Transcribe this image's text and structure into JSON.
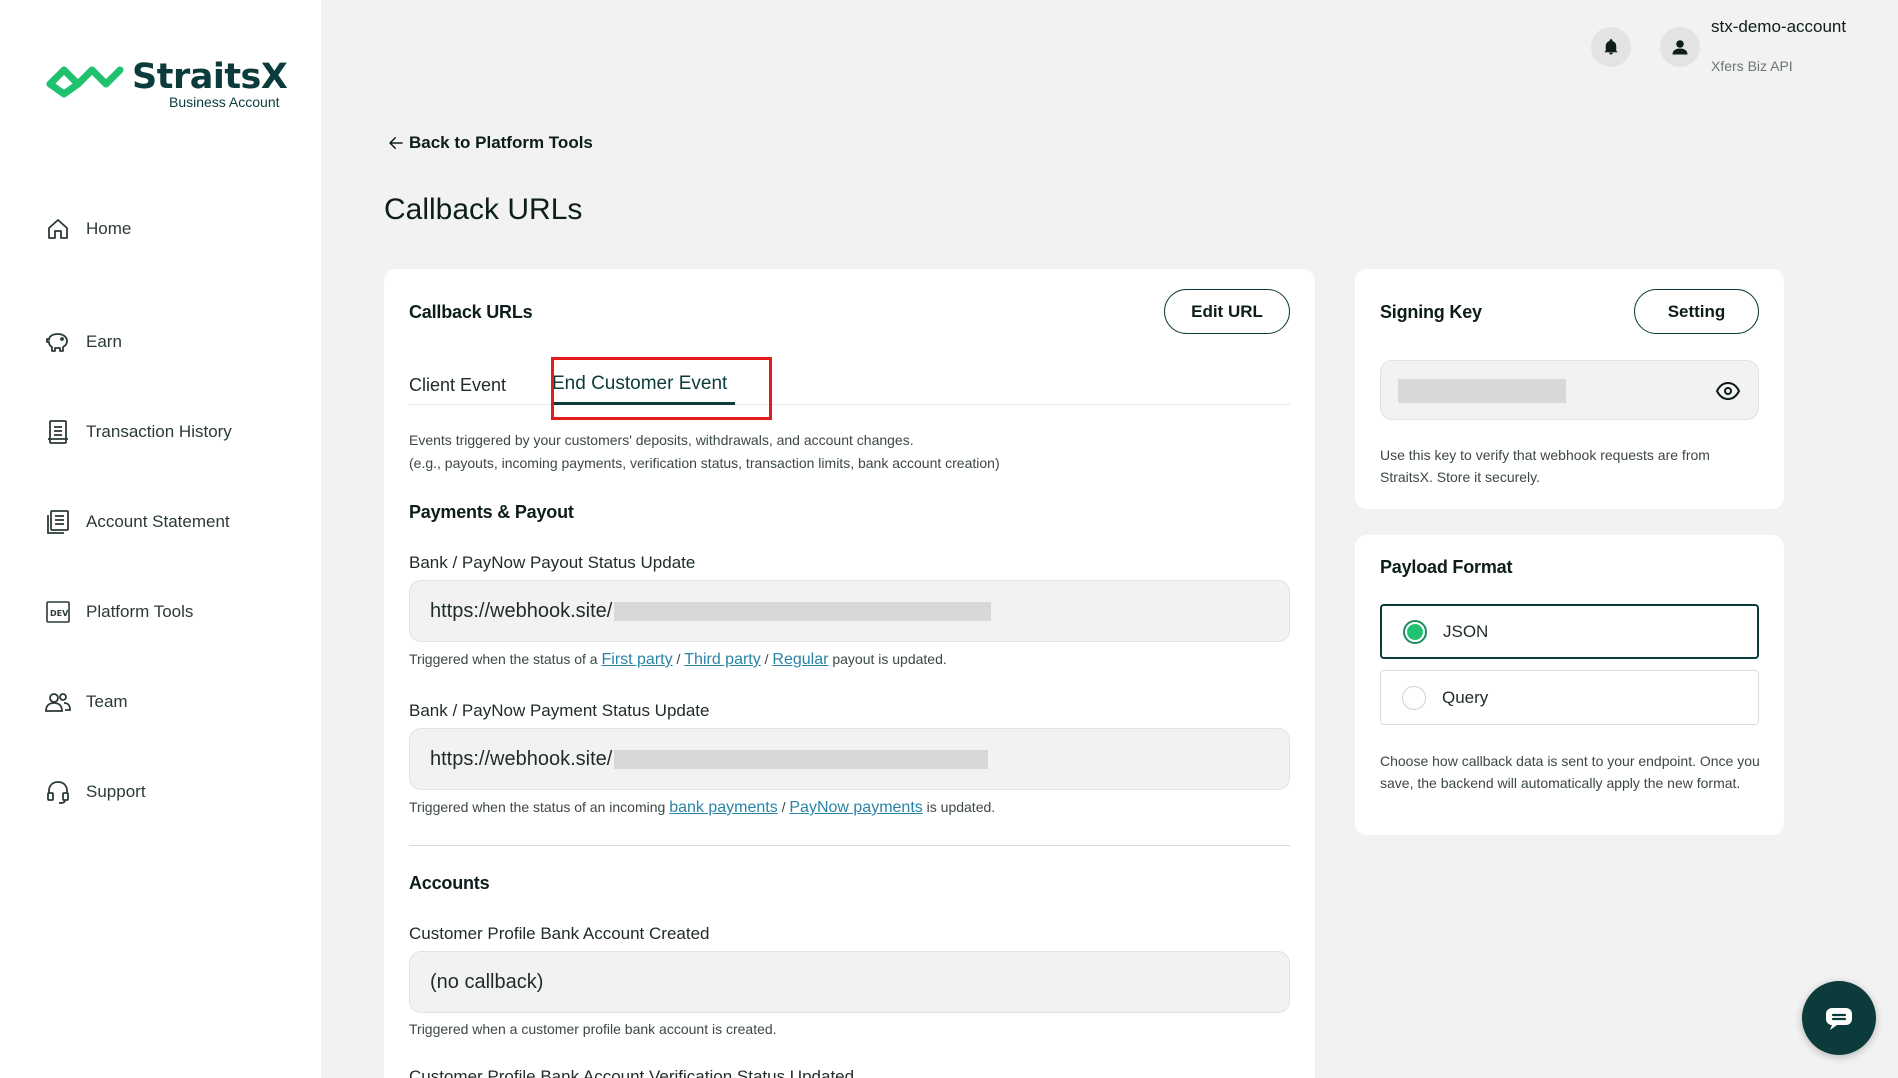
{
  "brand": {
    "name": "StraitsX",
    "subtitle": "Business Account",
    "color": "#0b3b3a",
    "accent": "#21c26f"
  },
  "sidebar": {
    "items": [
      {
        "label": "Home",
        "icon": "home-icon"
      },
      {
        "label": "Earn",
        "icon": "piggy-bank-icon"
      },
      {
        "label": "Transaction History",
        "icon": "receipt-icon"
      },
      {
        "label": "Account Statement",
        "icon": "statement-icon"
      },
      {
        "label": "Platform Tools",
        "icon": "dev-icon"
      },
      {
        "label": "Team",
        "icon": "team-icon"
      },
      {
        "label": "Support",
        "icon": "headset-icon"
      }
    ]
  },
  "header": {
    "account_name": "stx-demo-account",
    "account_sub": "Xfers Biz API"
  },
  "page": {
    "back_label": "Back to Platform Tools",
    "title": "Callback URLs"
  },
  "callbacks": {
    "title": "Callback URLs",
    "edit_label": "Edit URL",
    "tabs": [
      {
        "label": "Client Event"
      },
      {
        "label": "End Customer Event"
      }
    ],
    "description_line1": "Events triggered by your customers' deposits, withdrawals, and account changes.",
    "description_line2": "(e.g., payouts, incoming payments, verification status, transaction limits, bank account creation)",
    "section_payments": "Payments & Payout",
    "payout": {
      "label": "Bank / PayNow Payout Status Update",
      "value": "https://webhook.site/",
      "help_prefix": "Triggered when the status of a ",
      "link1": "First party",
      "sep1": " / ",
      "link2": "Third party",
      "sep2": " / ",
      "link3": "Regular",
      "help_suffix": " payout is updated."
    },
    "payment": {
      "label": "Bank / PayNow Payment Status Update",
      "value": "https://webhook.site/",
      "help_prefix": "Triggered when the status of an incoming ",
      "link1": "bank payments",
      "sep1": " / ",
      "link2": "PayNow payments",
      "help_suffix": " is updated."
    },
    "section_accounts": "Accounts",
    "bank_created": {
      "label": "Customer Profile Bank Account Created",
      "value": "(no callback)",
      "help": "Triggered when a customer profile bank account is created."
    },
    "next_label": "Customer Profile Bank Account Verification Status Updated"
  },
  "signing": {
    "title": "Signing Key",
    "setting_label": "Setting",
    "description": "Use this key to verify that webhook requests are from StraitsX. Store it securely."
  },
  "payload": {
    "title": "Payload Format",
    "options": [
      {
        "label": "JSON",
        "selected": true
      },
      {
        "label": "Query",
        "selected": false
      }
    ],
    "description": "Choose how callback data is sent to your endpoint. Once you save, the backend will automatically apply the new format."
  }
}
